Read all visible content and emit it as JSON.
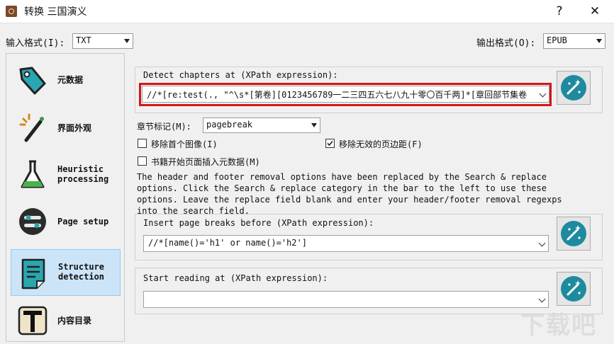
{
  "window": {
    "title": "转换 三国演义",
    "help_glyph": "?",
    "close_glyph": "✕"
  },
  "input_format": {
    "label": "输入格式(I):",
    "value": "TXT"
  },
  "output_format": {
    "label": "输出格式(O):",
    "value": "EPUB"
  },
  "sidebar": {
    "items": [
      {
        "label": "元数据",
        "icon": "metadata-tag-icon"
      },
      {
        "label": "界面外观",
        "icon": "magic-wand-icon"
      },
      {
        "label": "Heuristic processing",
        "icon": "flask-icon"
      },
      {
        "label": "Page setup",
        "icon": "page-setup-icon"
      },
      {
        "label": "Structure detection",
        "icon": "structure-detection-icon",
        "selected": true
      },
      {
        "label": "内容目录",
        "icon": "toc-t-icon"
      }
    ]
  },
  "detect_chapters": {
    "label": "Detect chapters at (XPath expression):",
    "value": "//*[re:test(., \"^\\s*[第卷][0123456789一二三四五六七八九十零〇百千两]*[章回部节集卷"
  },
  "chapter_mark": {
    "label": "章节标记(M):",
    "value": "pagebreak"
  },
  "checkboxes": {
    "remove_first_image": {
      "label": "移除首个图像(I)",
      "checked": false
    },
    "remove_fake_margins": {
      "label": "移除无效的页边距(F)",
      "checked": true
    },
    "insert_metadata": {
      "label": "书籍开始页面插入元数据(M)",
      "checked": false
    }
  },
  "note": "The header and footer removal options have been replaced by the Search & replace options. Click the Search & replace category in the bar to the left to use these options. Leave the replace field blank and enter your header/footer removal regexps into the search field.",
  "page_breaks": {
    "label": "Insert page breaks before (XPath expression):",
    "value": "//*[name()='h1' or name()='h2']"
  },
  "start_reading": {
    "label": "Start reading at (XPath expression):",
    "value": ""
  },
  "watermark": "下载吧",
  "colors": {
    "highlight": "#d01818",
    "selection": "#cce4f7",
    "wand": "#1e8aa0"
  }
}
